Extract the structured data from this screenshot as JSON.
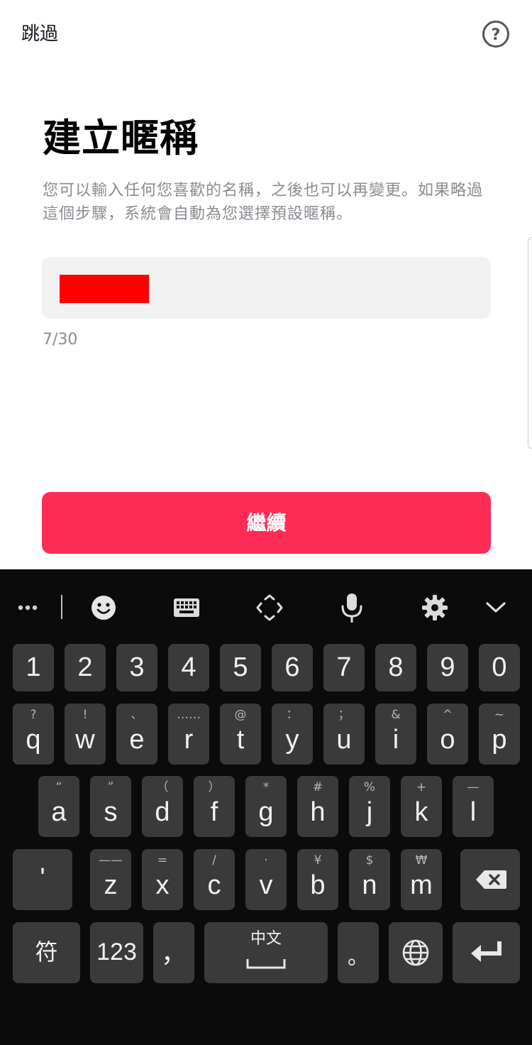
{
  "header": {
    "skip_label": "跳過",
    "help_label": "?"
  },
  "title": "建立暱稱",
  "description": "您可以輸入任何您喜歡的名稱，之後也可以再變更。如果略過這個步驟，系統會自動為您選擇預設暱稱。",
  "nickname": {
    "value": "",
    "counter": "7/30"
  },
  "continue_label": "繼續",
  "colors": {
    "primary": "#fe2c55",
    "field_bg": "#f1f1f2",
    "keyboard_bg": "#0b0b0b",
    "key_bg": "#3a3a3a",
    "redaction": "#ff0000"
  },
  "keyboard": {
    "toolbar": [
      "more-icon",
      "emoji-icon",
      "keyboard-icon",
      "cursor-move-icon",
      "mic-icon",
      "settings-icon",
      "chevron-down-icon"
    ],
    "row_numbers": [
      "1",
      "2",
      "3",
      "4",
      "5",
      "6",
      "7",
      "8",
      "9",
      "0"
    ],
    "row1": [
      {
        "key": "q",
        "hint": "?"
      },
      {
        "key": "w",
        "hint": "!"
      },
      {
        "key": "e",
        "hint": "、"
      },
      {
        "key": "r",
        "hint": "……"
      },
      {
        "key": "t",
        "hint": "@"
      },
      {
        "key": "y",
        "hint": "："
      },
      {
        "key": "u",
        "hint": "；"
      },
      {
        "key": "i",
        "hint": "&"
      },
      {
        "key": "o",
        "hint": "^"
      },
      {
        "key": "p",
        "hint": "~"
      }
    ],
    "row2": [
      {
        "key": "a",
        "hint": "“"
      },
      {
        "key": "s",
        "hint": "”"
      },
      {
        "key": "d",
        "hint": "（"
      },
      {
        "key": "f",
        "hint": "）"
      },
      {
        "key": "g",
        "hint": "*"
      },
      {
        "key": "h",
        "hint": "#"
      },
      {
        "key": "j",
        "hint": "%"
      },
      {
        "key": "k",
        "hint": "+"
      },
      {
        "key": "l",
        "hint": "—"
      }
    ],
    "row3": [
      {
        "key": "z",
        "hint": "——"
      },
      {
        "key": "x",
        "hint": "="
      },
      {
        "key": "c",
        "hint": "/"
      },
      {
        "key": "v",
        "hint": "·"
      },
      {
        "key": "b",
        "hint": "¥"
      },
      {
        "key": "n",
        "hint": "$"
      },
      {
        "key": "m",
        "hint": "₩"
      }
    ],
    "apostrophe": "'",
    "symbols": "符",
    "numbers": "123",
    "comma": "，",
    "space_label": "中文",
    "period": "。"
  }
}
